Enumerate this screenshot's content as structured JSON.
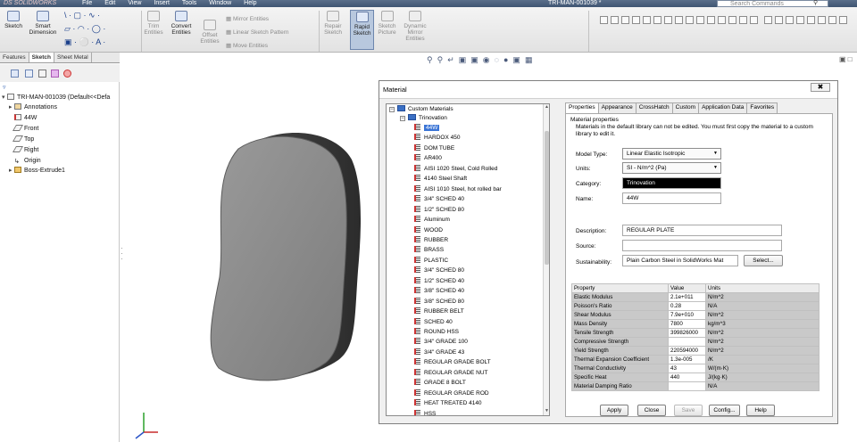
{
  "app": {
    "logo": "DS SOLIDWORKS",
    "menu": [
      "File",
      "Edit",
      "View",
      "Insert",
      "Tools",
      "Window",
      "Help"
    ],
    "document_title": "TRI-MAN-001039 *",
    "search_placeholder": "Search Commands"
  },
  "ribbon": {
    "sketch": "Sketch",
    "smart_dimension": [
      "Smart",
      "Dimension"
    ],
    "trim_entities": [
      "Trim",
      "Entities"
    ],
    "convert_entities": [
      "Convert",
      "Entities"
    ],
    "offset_entities": [
      "Offset",
      "Entities"
    ],
    "mirror_entities": "Mirror Entities",
    "linear_sketch_pattern": "Linear Sketch Pattern",
    "move_entities": "Move Entities",
    "repair_sketch": [
      "Repair",
      "Sketch"
    ],
    "rapid_sketch": [
      "Rapid",
      "Sketch"
    ],
    "sketch_picture": [
      "Sketch",
      "Picture"
    ],
    "dynamic_mirror": [
      "Dynamic",
      "Mirror",
      "Entities"
    ]
  },
  "panel": {
    "tabs": [
      "Features",
      "Sketch",
      "Sheet Metal"
    ],
    "selected_tab": "Sketch",
    "tree": [
      {
        "label": "TRI-MAN-001039  (Default<<Defa",
        "icon": "part-icon"
      },
      {
        "label": "Annotations",
        "icon": "annotations-icon"
      },
      {
        "label": "44W",
        "icon": "material-icon"
      },
      {
        "label": "Front",
        "icon": "plane-icon"
      },
      {
        "label": "Top",
        "icon": "plane-icon"
      },
      {
        "label": "Right",
        "icon": "plane-icon"
      },
      {
        "label": "Origin",
        "icon": "origin-icon"
      },
      {
        "label": "Boss-Extrude1",
        "icon": "extrude-icon"
      }
    ]
  },
  "dialog": {
    "title": "Material",
    "library": {
      "root": "Custom Materials",
      "folder": "Trinovation",
      "selected": "44W",
      "items": [
        "44W",
        "HARDOX 450",
        "DOM TUBE",
        "AR400",
        "AISI 1020 Steel, Cold Rolled",
        "4140 Steel Shaft",
        "AISI 1010 Steel, hot rolled bar",
        "3/4\" SCHED 40",
        "1/2\" SCHED  80",
        "Aluminum",
        "WOOD",
        "RUBBER",
        "BRASS",
        "PLASTIC",
        "3/4\" SCHED 80",
        "1/2\" SCHED 40",
        "3/8\" SCHED 40",
        "3/8\" SCHED  80",
        "RUBBER BELT",
        "SCHED 40",
        "ROUND HSS",
        "3/4\" GRADE 100",
        "3/4\" GRADE 43",
        "REGULAR GRADE BOLT",
        "REGULAR GRADE NUT",
        "GRADE 8 BOLT",
        "REGULAR GRADE ROD",
        "HEAT TREATED 4140",
        "HSS"
      ]
    },
    "tabs": [
      "Properties",
      "Appearance",
      "CrossHatch",
      "Custom",
      "Application Data",
      "Favorites"
    ],
    "selected_tab": "Properties",
    "properties": {
      "group_title": "Material properties",
      "note": "Materials in the default library can not be edited. You must first copy the material to a custom library to edit it.",
      "model_type_label": "Model Type:",
      "model_type": "Linear Elastic Isotropic",
      "units_label": "Units:",
      "units": "SI - N/m^2 (Pa)",
      "category_label": "Category:",
      "category": "Trinovation",
      "name_label": "Name:",
      "name": "44W",
      "description_label": "Description:",
      "description": "REGULAR PLATE",
      "source_label": "Source:",
      "source": "",
      "sustainability_label": "Sustainability:",
      "sustainability": "Plain Carbon Steel in SolidWorks Mat",
      "select_button": "Select..."
    },
    "table": {
      "headers": [
        "Property",
        "Value",
        "Units"
      ],
      "rows": [
        [
          "Elastic Modulus",
          "2.1e+011",
          "N/m^2"
        ],
        [
          "Poisson's Ratio",
          "0.28",
          "N/A"
        ],
        [
          "Shear Modulus",
          "7.9e+010",
          "N/m^2"
        ],
        [
          "Mass Density",
          "7800",
          "kg/m^3"
        ],
        [
          "Tensile Strength",
          "399826000",
          "N/m^2"
        ],
        [
          "Compressive Strength",
          "",
          "N/m^2"
        ],
        [
          "Yield Strength",
          "220594000",
          "N/m^2"
        ],
        [
          "Thermal Expansion Coefficient",
          "1.3e-005",
          "/K"
        ],
        [
          "Thermal Conductivity",
          "43",
          "W/(m·K)"
        ],
        [
          "Specific Heat",
          "440",
          "J/(kg·K)"
        ],
        [
          "Material Damping Ratio",
          "",
          "N/A"
        ]
      ]
    },
    "buttons": {
      "apply": "Apply",
      "close": "Close",
      "save": "Save",
      "config": "Config...",
      "help": "Help"
    }
  }
}
